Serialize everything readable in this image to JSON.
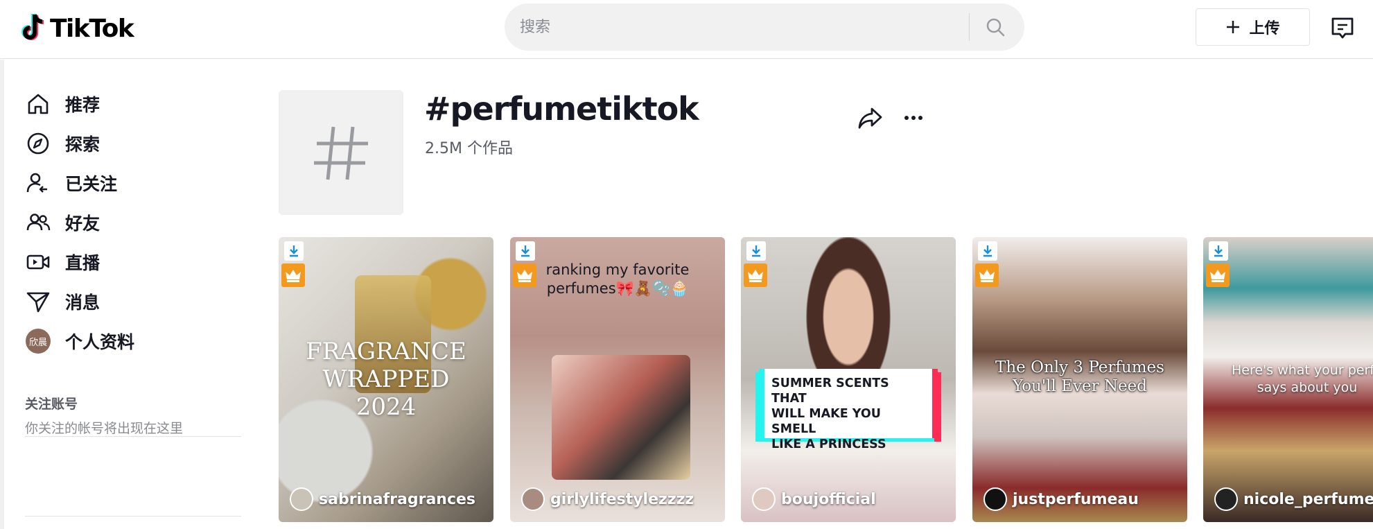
{
  "header": {
    "logo_text": "TikTok",
    "search_placeholder": "搜索",
    "upload_label": "上传"
  },
  "sidebar": {
    "items": [
      {
        "label": "推荐",
        "icon": "home-icon"
      },
      {
        "label": "探索",
        "icon": "compass-icon"
      },
      {
        "label": "已关注",
        "icon": "following-icon"
      },
      {
        "label": "好友",
        "icon": "friends-icon"
      },
      {
        "label": "直播",
        "icon": "live-icon"
      },
      {
        "label": "消息",
        "icon": "send-icon"
      },
      {
        "label": "个人资料",
        "icon": "avatar",
        "avatar_text": "欣晨"
      }
    ],
    "following_title": "关注账号",
    "following_desc": "你关注的帐号将出现在这里"
  },
  "tag": {
    "title": "#perfumetiktok",
    "count": "2.5M 个作品"
  },
  "videos": [
    {
      "author": "sabrinafragrances",
      "overlay": [
        "FRAGRANCE",
        "WRAPPED",
        "2024"
      ]
    },
    {
      "author": "girlylifestylezzzz",
      "overlay": [
        "ranking my favorite",
        "perfumes🎀🧸🫧🧁"
      ]
    },
    {
      "author": "boujofficial",
      "overlay": [
        "SUMMER SCENTS THAT",
        "WILL MAKE YOU SMELL",
        "LIKE A PRINCESS"
      ]
    },
    {
      "author": "justperfumeau",
      "overlay": [
        "The Only 3 Perfumes",
        "You'll Ever Need"
      ]
    },
    {
      "author": "nicole_perfumes",
      "overlay": [
        "Here's what your perfu",
        "says about you"
      ]
    }
  ],
  "colors": {
    "accent_cyan": "#25f4ee",
    "accent_red": "#fe2c55",
    "crown_badge": "#f39a1e",
    "download_badge": "#1a8fd8"
  }
}
